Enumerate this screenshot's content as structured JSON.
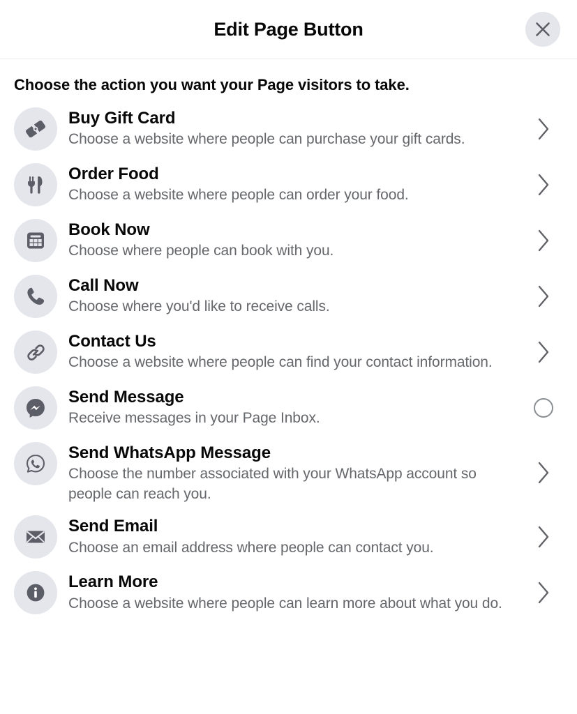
{
  "header": {
    "title": "Edit Page Button",
    "close_label": "Close",
    "close_icon": "close-icon"
  },
  "body": {
    "heading": "Choose the action you want your Page visitors to take.",
    "actions": [
      {
        "id": "buy-gift-card",
        "title": "Buy Gift Card",
        "description": "Choose a website where people can purchase your gift cards.",
        "icon": "gift-card-icon",
        "affordance": "chevron-right-icon"
      },
      {
        "id": "order-food",
        "title": "Order Food",
        "description": "Choose a website where people can order your food.",
        "icon": "fork-knife-icon",
        "affordance": "chevron-right-icon"
      },
      {
        "id": "book-now",
        "title": "Book Now",
        "description": "Choose where people can book with you.",
        "icon": "calendar-icon",
        "affordance": "chevron-right-icon"
      },
      {
        "id": "call-now",
        "title": "Call Now",
        "description": "Choose where you'd like to receive calls.",
        "icon": "phone-icon",
        "affordance": "chevron-right-icon"
      },
      {
        "id": "contact-us",
        "title": "Contact Us",
        "description": "Choose a website where people can find your contact information.",
        "icon": "link-chain-icon",
        "affordance": "chevron-right-icon"
      },
      {
        "id": "send-message",
        "title": "Send Message",
        "description": "Receive messages in your Page Inbox.",
        "icon": "messenger-icon",
        "affordance": "radio-unselected"
      },
      {
        "id": "send-whatsapp-message",
        "title": "Send WhatsApp Message",
        "description": "Choose the number associated with your WhatsApp account so people can reach you.",
        "icon": "whatsapp-icon",
        "affordance": "chevron-right-icon"
      },
      {
        "id": "send-email",
        "title": "Send Email",
        "description": "Choose an email address where people can contact you.",
        "icon": "envelope-icon",
        "affordance": "chevron-right-icon"
      },
      {
        "id": "learn-more",
        "title": "Learn More",
        "description": "Choose a website where people can learn more about what you do.",
        "icon": "info-icon",
        "affordance": "chevron-right-icon"
      }
    ]
  },
  "colors": {
    "background": "#ffffff",
    "primary_text": "#080809",
    "secondary_text": "#65676b",
    "icon_circle_bg": "#e4e6eb",
    "icon_glyph": "#5b5e66",
    "divider": "#e8eaed",
    "chevron": "#606266"
  }
}
